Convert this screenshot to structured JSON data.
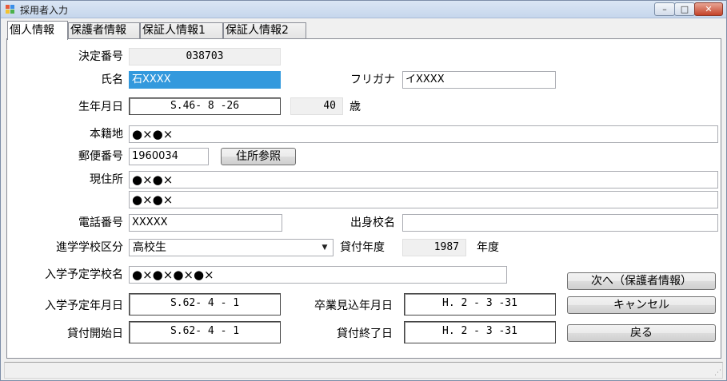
{
  "window": {
    "title": "採用者入力",
    "minimize": "–",
    "maximize": "□",
    "close": "✕"
  },
  "tabs": [
    {
      "label": "個人情報",
      "active": true
    },
    {
      "label": "保護者情報",
      "active": false
    },
    {
      "label": "保証人情報1",
      "active": false
    },
    {
      "label": "保証人情報2",
      "active": false
    }
  ],
  "form": {
    "decision_no": {
      "label": "決定番号",
      "value": "038703"
    },
    "name": {
      "label": "氏名",
      "value": "石XXXX"
    },
    "furigana": {
      "label": "フリガナ",
      "value": "イXXXX"
    },
    "birth": {
      "label": "生年月日",
      "value": "S.46- 8 -26",
      "age": "40",
      "age_unit": "歳"
    },
    "domicile": {
      "label": "本籍地",
      "value": "●×●×"
    },
    "postal": {
      "label": "郵便番号",
      "value": "1960034",
      "lookup_button": "住所参照"
    },
    "address": {
      "label": "現住所",
      "line1": "●×●×",
      "line2": "●×●×"
    },
    "phone": {
      "label": "電話番号",
      "value": "XXXXX"
    },
    "alma_mater": {
      "label": "出身校名",
      "value": ""
    },
    "school_type": {
      "label": "進学学校区分",
      "value": "高校生"
    },
    "loan_year": {
      "label": "貸付年度",
      "value": "1987",
      "unit": "年度"
    },
    "school_name": {
      "label": "入学予定学校名",
      "value": "●×●×●×●×"
    },
    "enroll_date": {
      "label": "入学予定年月日",
      "value": "S.62- 4 - 1"
    },
    "grad_date": {
      "label": "卒業見込年月日",
      "value": "H. 2 - 3 -31"
    },
    "loan_start": {
      "label": "貸付開始日",
      "value": "S.62- 4 - 1"
    },
    "loan_end": {
      "label": "貸付終了日",
      "value": "H. 2 - 3 -31"
    }
  },
  "buttons": {
    "next": "次へ（保護者情報）",
    "cancel": "キャンセル",
    "back": "戻る"
  },
  "status": {
    "grip": "⋰"
  }
}
